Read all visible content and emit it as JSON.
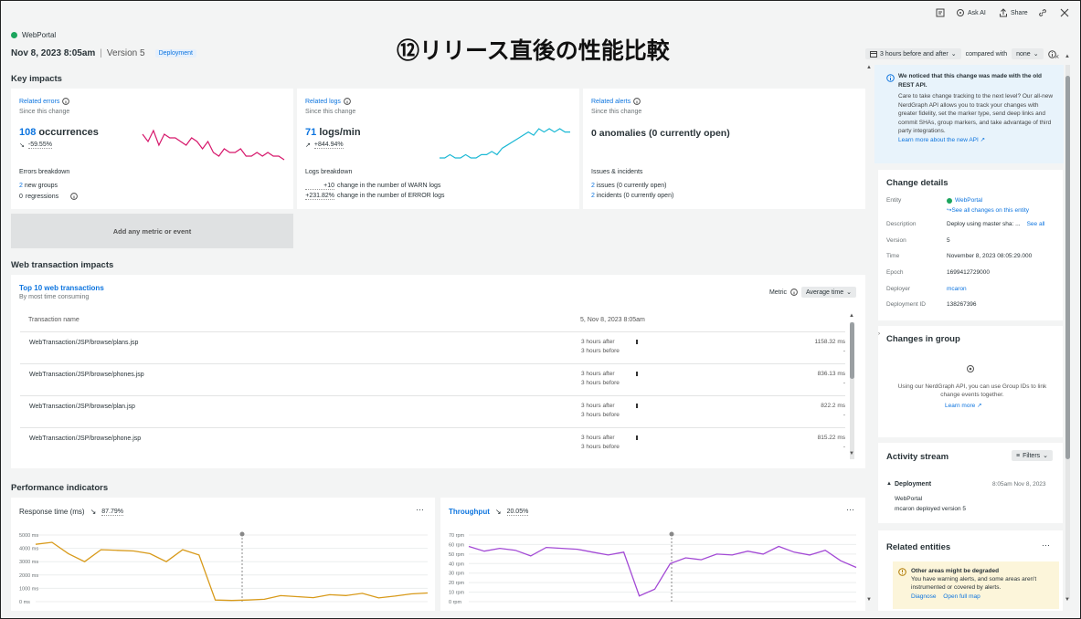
{
  "toolbar": {
    "ask_ai": "Ask AI",
    "share": "Share"
  },
  "header": {
    "entity": "WebPortal",
    "datetime": "Nov 8, 2023 8:05am",
    "version": "Version 5",
    "badge": "Deployment",
    "slide_title": "⑫リリース直後の性能比較",
    "time_range": "3 hours before and after",
    "compared_with_label": "compared with",
    "compared_with_value": "none"
  },
  "key_impacts": {
    "title": "Key impacts",
    "errors": {
      "label": "Related errors",
      "since": "Since this change",
      "count": "108",
      "unit": "occurrences",
      "delta": "-59.55%",
      "breakdown_title": "Errors breakdown",
      "new_groups_count": "2",
      "new_groups_label": "new groups",
      "regressions_count": "0",
      "regressions_label": "regressions"
    },
    "logs": {
      "label": "Related logs",
      "since": "Since this change",
      "count": "71",
      "unit": "logs/min",
      "delta": "+844.94%",
      "breakdown_title": "Logs breakdown",
      "warn_change": "+10",
      "warn_text": "change in the number of WARN logs",
      "error_change": "+231.82%",
      "error_text": "change in the number of ERROR logs"
    },
    "alerts": {
      "label": "Related alerts",
      "since": "Since this change",
      "summary": "0 anomalies (0 currently open)",
      "issues_title": "Issues & incidents",
      "issues_count": "2",
      "issues_text": "issues (0 currently open)",
      "incidents_count": "2",
      "incidents_text": "incidents (0 currently open)"
    },
    "add_metric": "Add any metric or event"
  },
  "web_tx": {
    "title": "Web transaction impacts",
    "card_title": "Top 10 web transactions",
    "card_sub": "By most time consuming",
    "metric_label": "Metric",
    "metric_value": "Average time",
    "col_name": "Transaction name",
    "col_time": "5, Nov 8, 2023 8:05am",
    "after_label": "3 hours after",
    "before_label": "3 hours before",
    "rows": [
      {
        "name": "WebTransaction/JSP/browse/plans.jsp",
        "value": "1158.32 ms",
        "before": "-"
      },
      {
        "name": "WebTransaction/JSP/browse/phones.jsp",
        "value": "836.13 ms",
        "before": "-"
      },
      {
        "name": "WebTransaction/JSP/browse/plan.jsp",
        "value": "822.2 ms",
        "before": "-"
      },
      {
        "name": "WebTransaction/JSP/browse/phone.jsp",
        "value": "815.22 ms",
        "before": "-"
      }
    ]
  },
  "perf": {
    "title": "Performance indicators",
    "response": {
      "label": "Response time (ms)",
      "delta": "87.79%",
      "y_ticks": [
        "5000 ms",
        "4000 ms",
        "3000 ms",
        "2000 ms",
        "1000 ms",
        "0 ms"
      ]
    },
    "throughput": {
      "label": "Throughput",
      "delta": "20.05%",
      "y_ticks": [
        "70 rpm",
        "60 rpm",
        "50 rpm",
        "40 rpm",
        "30 rpm",
        "20 rpm",
        "10 rpm",
        "0 rpm"
      ]
    }
  },
  "sidebar": {
    "notice_title": "We noticed that this change was made with the old REST API.",
    "notice_body": "Care to take change tracking to the next level? Our all-new NerdGraph API allows you to track your changes with greater fidelity, set the marker type, send deep links and commit SHAs, group markers, and take advantage of third party integrations.",
    "notice_link": "Learn more about the new API",
    "change_details_title": "Change details",
    "details": {
      "entity_label": "Entity",
      "entity_value": "WebPortal",
      "see_all_changes": "See all changes on this entity",
      "description_label": "Description",
      "description_value": "Deploy using master sha: ...",
      "see_all": "See all",
      "version_label": "Version",
      "version_value": "5",
      "time_label": "Time",
      "time_value": "November 8, 2023 08:05:29.000",
      "epoch_label": "Epoch",
      "epoch_value": "1699412729000",
      "deployer_label": "Deployer",
      "deployer_value": "mcaron",
      "deployment_id_label": "Deployment ID",
      "deployment_id_value": "138267396"
    },
    "group_title": "Changes in group",
    "group_body": "Using our NerdGraph API, you can use Group IDs to link change events together.",
    "group_link": "Learn more",
    "activity_title": "Activity stream",
    "filters": "Filters",
    "activity_item_title": "Deployment",
    "activity_item_time": "8:05am Nov 8, 2023",
    "activity_item_entity": "WebPortal",
    "activity_item_desc": "mcaron deployed version 5",
    "related_title": "Related entities",
    "warning_title": "Other areas might be degraded",
    "warning_body": "You have warning alerts, and some areas aren't instrumented or covered by alerts.",
    "diagnose": "Diagnose",
    "open_map": "Open full map"
  },
  "colors": {
    "accent": "#0c74df",
    "errors_line": "#d6176b",
    "logs_line": "#1ab8d4",
    "response_line": "#d89a1a",
    "throughput_line": "#a34ad5",
    "green": "#1ca55d"
  },
  "chart_data": [
    {
      "type": "line",
      "series": [
        {
          "values": [
            8,
            6,
            9,
            5,
            8,
            7,
            7,
            6,
            5,
            7,
            6,
            4,
            6,
            3,
            2,
            4,
            3,
            3,
            4,
            2,
            2,
            3,
            2,
            3,
            2,
            2,
            1
          ]
        }
      ]
    },
    {
      "type": "line",
      "series": [
        {
          "values": [
            1,
            1,
            2,
            1,
            1,
            2,
            1,
            1,
            2,
            2,
            3,
            2,
            4,
            5,
            6,
            7,
            8,
            9,
            8,
            10,
            9,
            10,
            9,
            10,
            9,
            9
          ]
        }
      ]
    },
    {
      "type": "line",
      "ylim": [
        0,
        5000
      ],
      "series": [
        {
          "values": [
            4300,
            4450,
            3600,
            3000,
            3900,
            3850,
            3800,
            3600,
            3000,
            3900,
            3500,
            120,
            90,
            120,
            180,
            450,
            380,
            300,
            520,
            460,
            620,
            280,
            420,
            580,
            650
          ]
        }
      ]
    },
    {
      "type": "line",
      "ylim": [
        0,
        70
      ],
      "series": [
        {
          "values": [
            58,
            53,
            56,
            54,
            48,
            57,
            56,
            55,
            52,
            49,
            52,
            6,
            13,
            40,
            46,
            44,
            50,
            49,
            53,
            50,
            58,
            52,
            49,
            54,
            43,
            36
          ]
        }
      ]
    }
  ]
}
